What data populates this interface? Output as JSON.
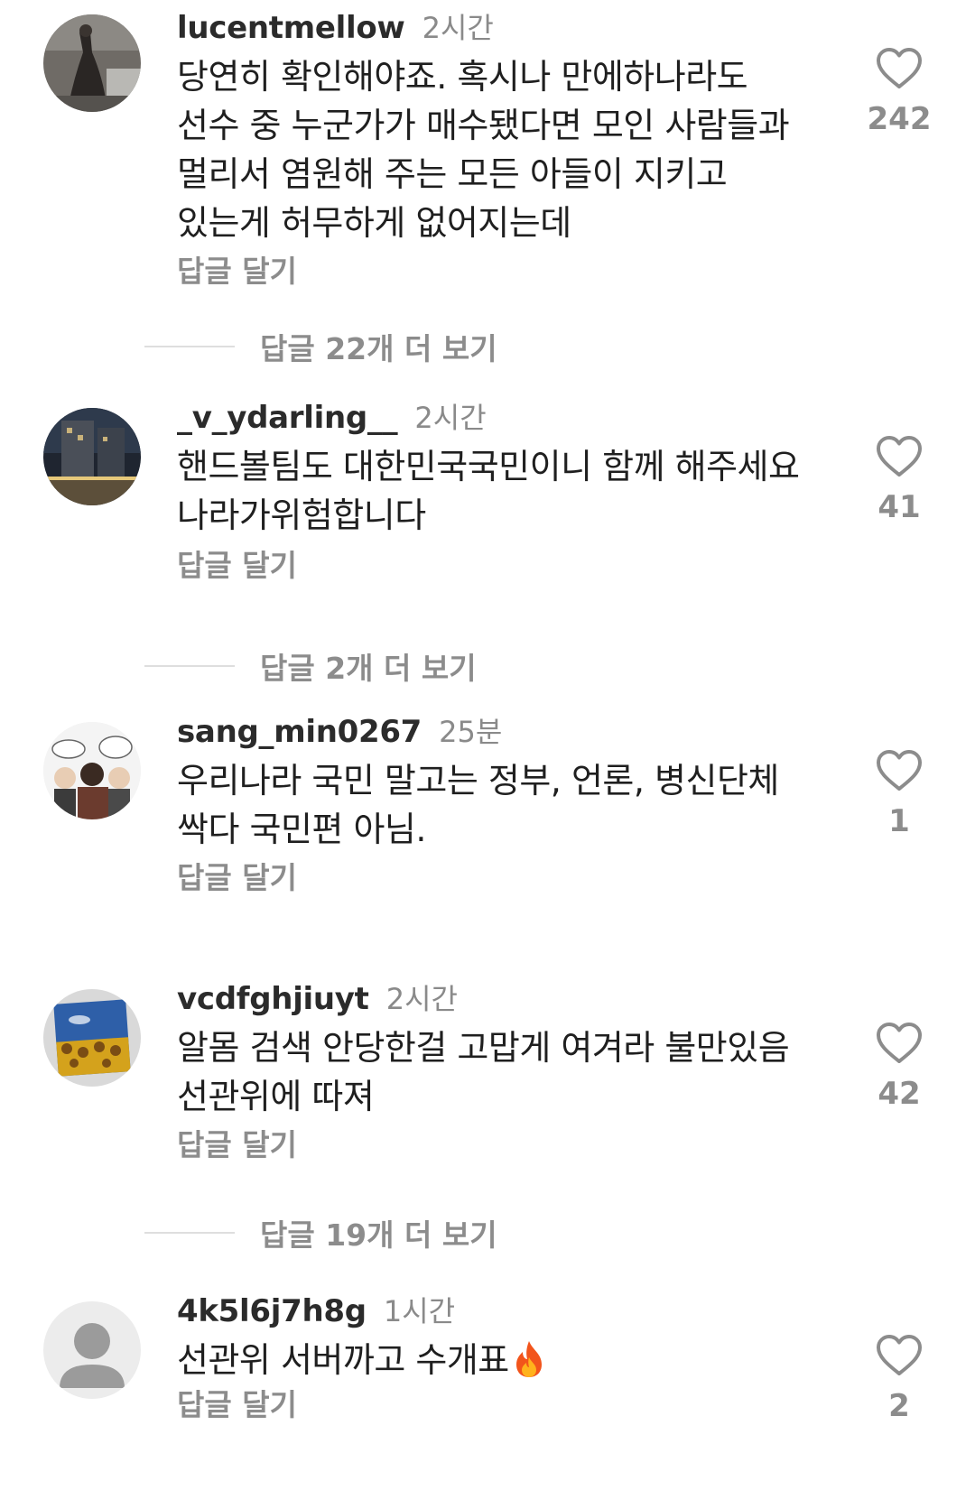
{
  "reply_label": "답글 달기",
  "comments": [
    {
      "username": "lucentmellow",
      "time": "2시간",
      "lines": [
        "당연히 확인해야죠. 혹시나 만에하나라도",
        "선수 중 누군가가 매수됐다면 모인 사람들과",
        "멀리서 염원해 주는 모든 아들이 지키고",
        "있는게 허무하게 없어지는데"
      ],
      "likes": "242",
      "avatar_icon": "dark-photo-avatar"
    },
    {
      "username": "_v_ydarling__",
      "time": "2시간",
      "lines": [
        "핸드볼팀도 대한민국국민이니 함께 해주세요",
        "나라가위험합니다"
      ],
      "likes": "41",
      "avatar_icon": "city-night-avatar"
    },
    {
      "username": "sang_min0267",
      "time": "25분",
      "lines": [
        "우리나라 국민 말고는 정부, 언론, 병신단체",
        "싹다 국민편 아님."
      ],
      "likes": "1",
      "avatar_icon": "cartoon-avatar"
    },
    {
      "username": "vcdfghjiuyt",
      "time": "2시간",
      "lines": [
        "알몸 검색 안당한걸 고맙게 여겨라 불만있음",
        "선관위에 따져"
      ],
      "likes": "42",
      "avatar_icon": "sunflower-avatar"
    },
    {
      "username": "4k5l6j7h8g",
      "time": "1시간",
      "lines": [
        "선관위 서버까고 수개표"
      ],
      "likes": "2",
      "avatar_icon": "default-user-avatar",
      "emoji": "fire-emoji"
    }
  ],
  "more_replies": [
    "답글 22개 더 보기",
    "답글 2개 더 보기",
    "답글 19개 더 보기"
  ],
  "colors": {
    "text": "#1f1f1f",
    "muted": "#8c8c8c",
    "heart": "#8c8c8c",
    "divider": "#dedede"
  }
}
